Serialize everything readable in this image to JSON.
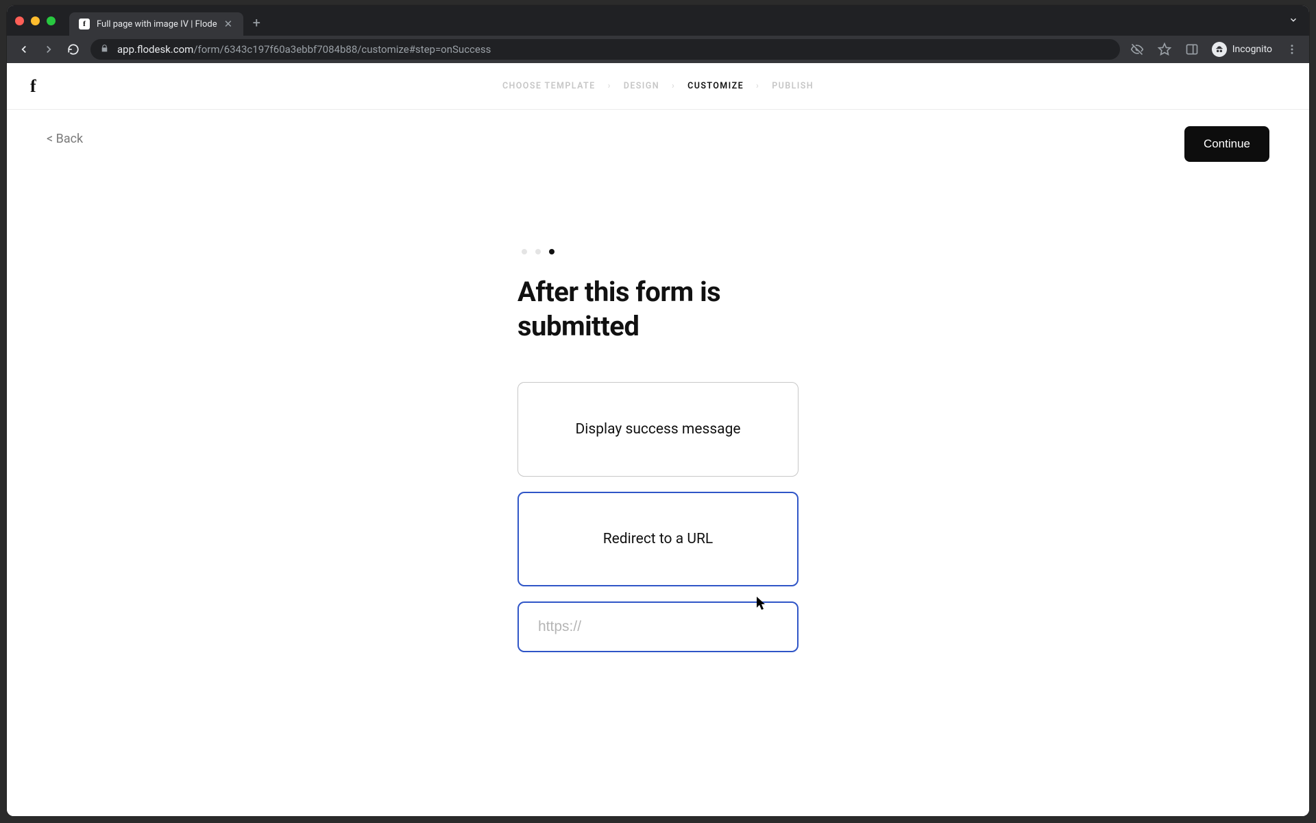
{
  "browser": {
    "tab_title": "Full page with image IV | Flode",
    "url_host": "app.flodesk.com",
    "url_path": "/form/6343c197f60a3ebbf7084b88/customize#step=onSuccess",
    "incognito_label": "Incognito"
  },
  "header": {
    "steps": [
      "CHOOSE TEMPLATE",
      "DESIGN",
      "CUSTOMIZE",
      "PUBLISH"
    ],
    "active_step_index": 2
  },
  "page": {
    "back_label": "< Back",
    "continue_label": "Continue",
    "title": "After this form is submitted",
    "options": {
      "display_success": "Display success message",
      "redirect_url": "Redirect to a URL"
    },
    "url_placeholder": "https://",
    "url_value": "",
    "dots_total": 3,
    "dots_active_index": 2
  }
}
